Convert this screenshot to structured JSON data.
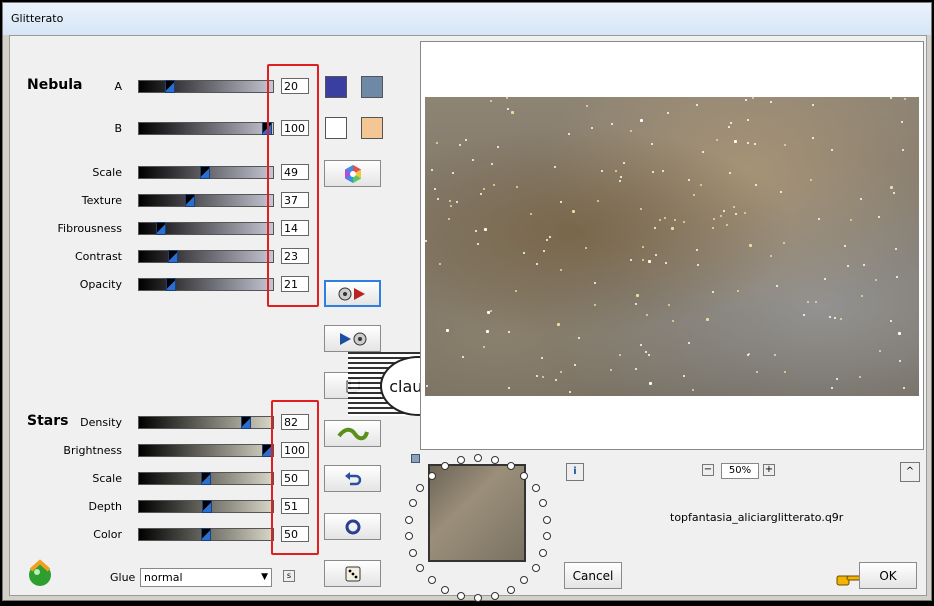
{
  "window": {
    "title": "Glitterato"
  },
  "nebula": {
    "title": "Nebula",
    "rows": [
      {
        "label": "A",
        "value": "20"
      },
      {
        "label": "B",
        "value": "100"
      },
      {
        "label": "Scale",
        "value": "49"
      },
      {
        "label": "Texture",
        "value": "37"
      },
      {
        "label": "Fibrousness",
        "value": "14"
      },
      {
        "label": "Contrast",
        "value": "23"
      },
      {
        "label": "Opacity",
        "value": "21"
      }
    ],
    "colors": {
      "a_left": "#3a3ea0",
      "a_right": "#6d89a5",
      "b_left": "#ffffff",
      "b_right": "#f4c595"
    }
  },
  "stars": {
    "title": "Stars",
    "rows": [
      {
        "label": "Density",
        "value": "82"
      },
      {
        "label": "Brightness",
        "value": "100"
      },
      {
        "label": "Scale",
        "value": "50"
      },
      {
        "label": "Depth",
        "value": "51"
      },
      {
        "label": "Color",
        "value": "50"
      }
    ]
  },
  "glue": {
    "label": "Glue",
    "value": "normal"
  },
  "watermark": {
    "text": "claudia"
  },
  "zoom": {
    "value": "50%",
    "minus": "−",
    "plus": "+"
  },
  "info_symbol": "i",
  "caret_symbol": "^",
  "small_s": "s",
  "filename": "topfantasia_aliciarglitterato.q9r",
  "buttons": {
    "cancel": "Cancel",
    "ok": "OK"
  },
  "accent_colors": {
    "highlight_box": "#e02020",
    "active_button": "#2f7fe0"
  }
}
